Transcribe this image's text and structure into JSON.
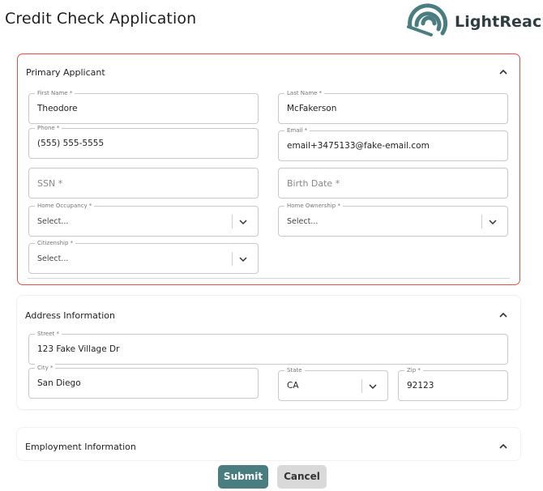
{
  "page": {
    "title": "Credit Check Application"
  },
  "brand": {
    "name": "LightReach",
    "accent": "#4a7d7f",
    "highlight_border": "#e05243"
  },
  "primary_applicant": {
    "title": "Primary Applicant",
    "first_name": {
      "label": "First Name *",
      "value": "Theodore"
    },
    "last_name": {
      "label": "Last Name *",
      "value": "McFakerson"
    },
    "phone": {
      "label": "Phone *",
      "value": "(555) 555-5555"
    },
    "email": {
      "label": "Email *",
      "value": "email+3475133@fake-email.com"
    },
    "ssn": {
      "placeholder": "SSN *"
    },
    "birth_date": {
      "placeholder": "Birth Date *"
    },
    "home_occupancy": {
      "label": "Home Occupancy *",
      "value": "Select..."
    },
    "home_ownership": {
      "label": "Home Ownership *",
      "value": "Select..."
    },
    "citizenship": {
      "label": "Citizenship *",
      "value": "Select..."
    }
  },
  "address": {
    "title": "Address Information",
    "street": {
      "label": "Street *",
      "value": "123 Fake Village Dr"
    },
    "city": {
      "label": "City *",
      "value": "San Diego"
    },
    "state": {
      "label": "State",
      "value": "CA"
    },
    "zip": {
      "label": "Zip *",
      "value": "92123"
    }
  },
  "employment": {
    "title": "Employment Information"
  },
  "actions": {
    "submit": "Submit",
    "cancel": "Cancel"
  },
  "icons": {
    "collapse": "chevron-up-icon",
    "dropdown": "chevron-down-icon",
    "logo": "lightreach-logo-icon"
  }
}
